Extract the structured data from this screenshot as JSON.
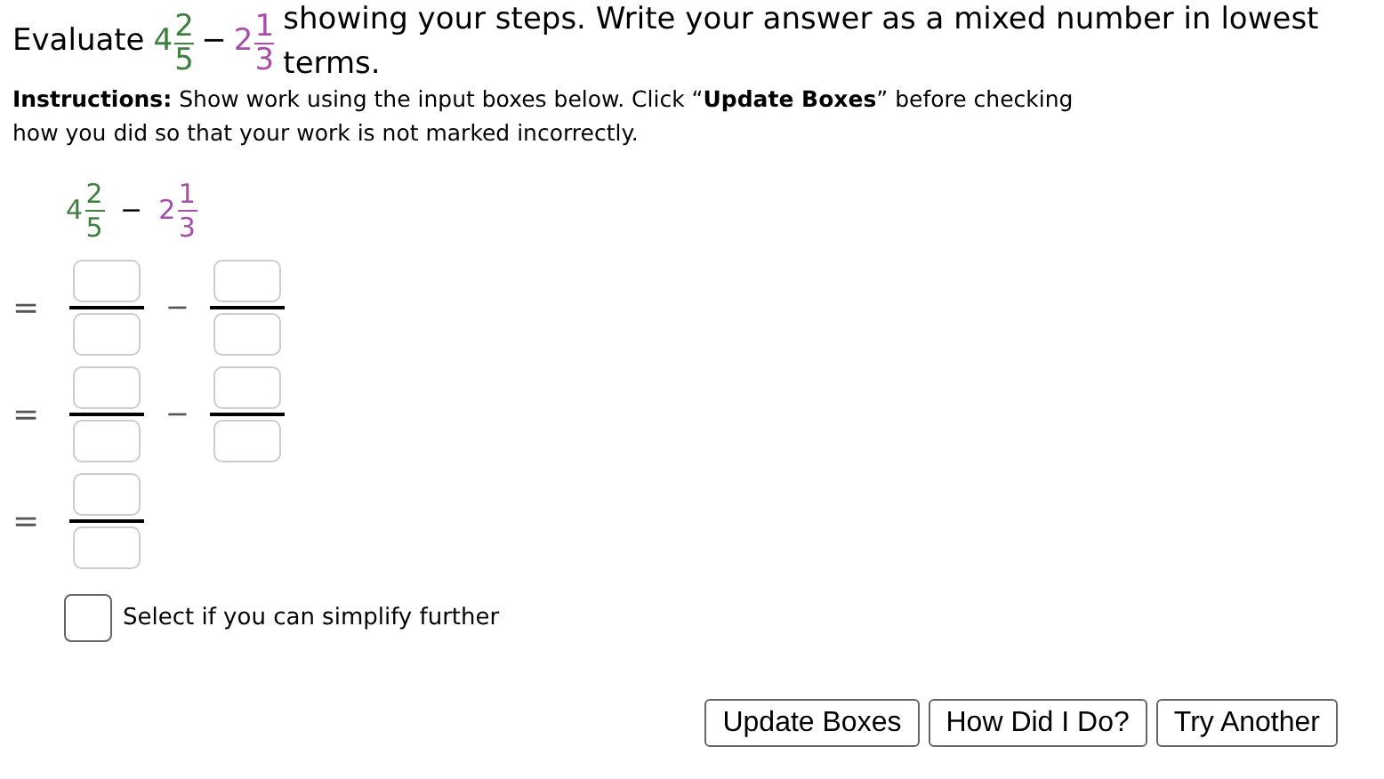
{
  "question": {
    "lead": "Evaluate",
    "expression": [
      {
        "whole": "4",
        "numerator": "2",
        "denominator": "5",
        "color": "#3f7f3f"
      },
      {
        "operator": "−"
      },
      {
        "whole": "2",
        "numerator": "1",
        "denominator": "3",
        "color": "#a54fa8"
      }
    ],
    "tail": "showing your steps. Write your answer as a mixed number in lowest terms."
  },
  "instructions": "**Instructions:** Show work using the input boxes below. Click “**Update Boxes**” before checking how you did so that your work is not marked incorrectly.",
  "work_expression": [
    {
      "whole": "4",
      "numerator": "2",
      "denominator": "5",
      "color": "#3f7f3f"
    },
    {
      "operator": "−"
    },
    {
      "whole": "2",
      "numerator": "1",
      "denominator": "3",
      "color": "#a54fa8"
    }
  ],
  "steps": [
    {
      "relation": "=",
      "terms": [
        {
          "kind": "fraction-input"
        },
        {
          "operator": "−"
        },
        {
          "kind": "fraction-input"
        }
      ]
    },
    {
      "relation": "=",
      "terms": [
        {
          "kind": "fraction-input"
        },
        {
          "operator": "−"
        },
        {
          "kind": "fraction-input"
        }
      ]
    },
    {
      "relation": "=",
      "terms": [
        {
          "kind": "fraction-input"
        }
      ]
    }
  ],
  "simplify": {
    "label": "Select if you can simplify further",
    "checked": false
  },
  "buttons": [
    "Update Boxes",
    "How Did I Do?",
    "Try Another"
  ]
}
